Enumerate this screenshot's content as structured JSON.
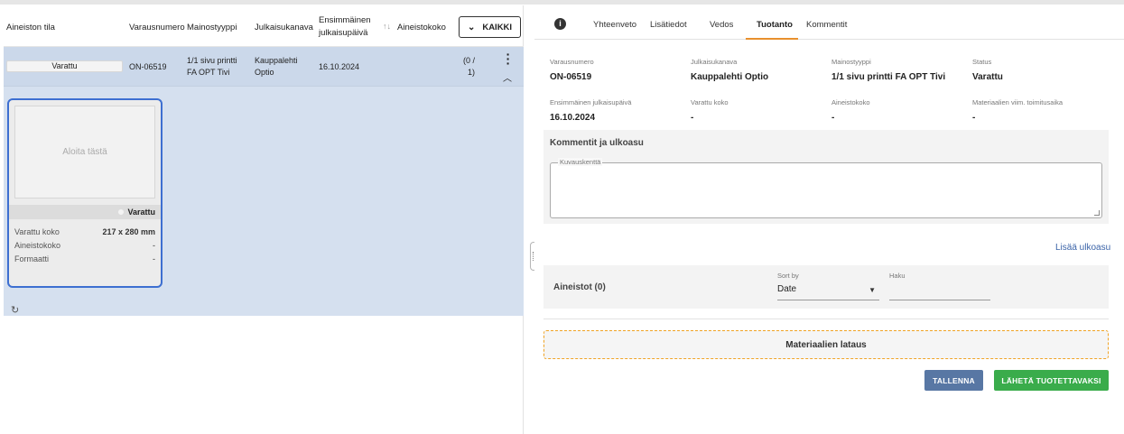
{
  "list": {
    "headers": {
      "status": "Aineiston tila",
      "number": "Varausnumero",
      "ad_type": "Mainostyyppi",
      "channel": "Julkaisukanava",
      "first_date_line1": "Ensimmäinen",
      "first_date_line2": "julkaisupäivä",
      "asset_size": "Aineistokoko"
    },
    "filter_button": "KAIKKI",
    "row": {
      "status": "Varattu",
      "number": "ON-06519",
      "ad_type_line1": "1/1 sivu printti",
      "ad_type_line2": "FA OPT Tivi",
      "channel_line1": "Kauppalehti",
      "channel_line2": "Optio",
      "first_date": "16.10.2024",
      "count_line1": "(0 /",
      "count_line2": "1)"
    },
    "card": {
      "placeholder": "Aloita tästä",
      "status": "Varattu",
      "rows": [
        {
          "label": "Varattu koko",
          "value": "217 x 280 mm"
        },
        {
          "label": "Aineistokoko",
          "value": "-"
        },
        {
          "label": "Formaatti",
          "value": "-"
        }
      ]
    }
  },
  "detail": {
    "tabs": [
      "Yhteenveto",
      "Lisätiedot",
      "Vedos",
      "Tuotanto",
      "Kommentit"
    ],
    "active_tab": "Tuotanto",
    "fields": [
      {
        "label": "Varausnumero",
        "value": "ON-06519"
      },
      {
        "label": "Julkaisukanava",
        "value": "Kauppalehti Optio"
      },
      {
        "label": "Mainostyyppi",
        "value": "1/1 sivu printti FA OPT Tivi"
      },
      {
        "label": "Status",
        "value": "Varattu"
      },
      {
        "label": "Ensimmäinen julkaisupäivä",
        "value": "16.10.2024"
      },
      {
        "label": "Varattu koko",
        "value": "-"
      },
      {
        "label": "Aineistokoko",
        "value": "-"
      },
      {
        "label": "Materiaalien viim. toimitusaika",
        "value": "-"
      }
    ],
    "comments": {
      "title": "Kommentit ja ulkoasu",
      "textarea_label": "Kuvauskenttä"
    },
    "add_layout": "Lisää ulkoasu",
    "assets": {
      "title": "Aineistot (0)",
      "sort_label": "Sort by",
      "sort_value": "Date",
      "search_label": "Haku"
    },
    "upload_label": "Materiaalien lataus",
    "save_button": "TALLENNA",
    "send_button": "LÄHETÄ TUOTETTAVAKSI"
  }
}
